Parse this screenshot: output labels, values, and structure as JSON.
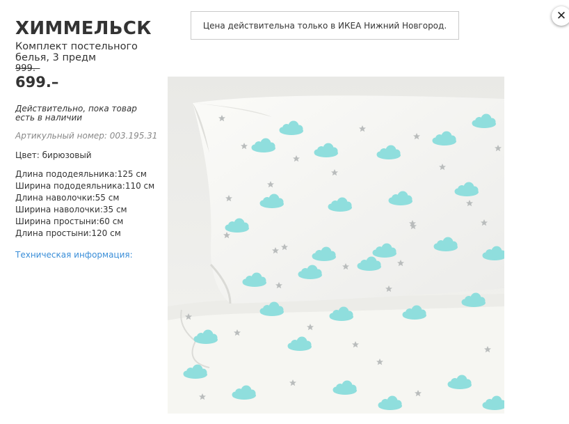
{
  "product": {
    "name": "ХИММЕЛЬСК",
    "subtitle": "Комплект постельного белья, 3 предм",
    "old_price": "999.–",
    "price": "699.–",
    "availability_note": "Действительно, пока товар есть в наличии",
    "article_label": "Артикульный номер: 003.195.31",
    "color_label": "Цвет: бирюзовый",
    "specs": [
      "Длина пододеяльника:125 см",
      "Ширина пододеяльника:110 см",
      "Длина наволочки:55 см",
      "Ширина наволочки:35 см",
      "Ширина простыни:60 см",
      "Длина простыни:120 см"
    ],
    "tech_info_link": "Техническая информация:"
  },
  "notice": "Цена действительна только в ИКЕА Нижний Новгород.",
  "close_icon": "close-icon",
  "colors": {
    "cloud": "#8fdedd",
    "star": "#b9bcbc",
    "fabric": "#f7f7f3",
    "link": "#3a8ed8"
  }
}
